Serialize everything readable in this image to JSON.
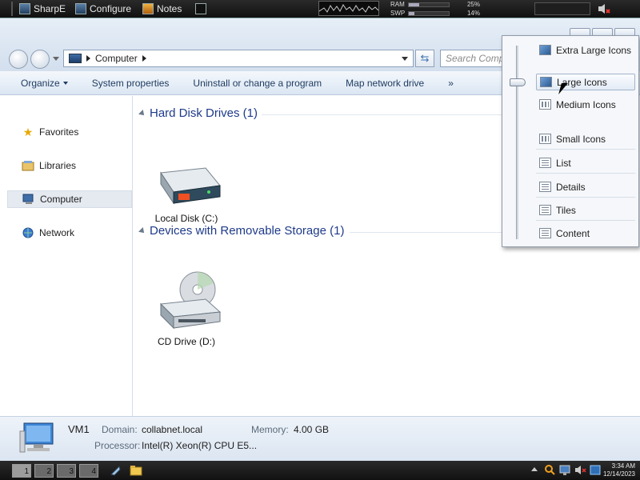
{
  "topbar": {
    "apps": [
      "SharpE",
      "Configure",
      "Notes"
    ],
    "meters": [
      {
        "label": "RAM",
        "percent": "25%",
        "level": 0.25
      },
      {
        "label": "SWP",
        "percent": "14%",
        "level": 0.14
      }
    ]
  },
  "address": {
    "crumb": "Computer",
    "search_placeholder": "Search Comp"
  },
  "commands": {
    "organize": "Organize",
    "system_properties": "System properties",
    "uninstall": "Uninstall or change a program",
    "map_drive": "Map network drive",
    "more": "»"
  },
  "nav": {
    "favorites": "Favorites",
    "libraries": "Libraries",
    "computer": "Computer",
    "network": "Network"
  },
  "groups": {
    "hdd_title": "Hard Disk Drives (1)",
    "removable_title": "Devices with Removable Storage (1)"
  },
  "drives": {
    "local_disk": "Local Disk (C:)",
    "cd_drive": "CD Drive (D:)"
  },
  "details": {
    "name": "VM1",
    "domain_label": "Domain:",
    "domain_value": "collabnet.local",
    "memory_label": "Memory:",
    "memory_value": "4.00 GB",
    "processor_label": "Processor:",
    "processor_value": "Intel(R) Xeon(R) CPU E5..."
  },
  "view_menu": {
    "extra_large": "Extra Large Icons",
    "large": "Large Icons",
    "medium": "Medium Icons",
    "small": "Small Icons",
    "list": "List",
    "details": "Details",
    "tiles": "Tiles",
    "content": "Content"
  },
  "taskbar": {
    "workspaces": [
      "1",
      "2",
      "3",
      "4"
    ],
    "time": "3:34 AM",
    "date": "12/14/2023"
  }
}
